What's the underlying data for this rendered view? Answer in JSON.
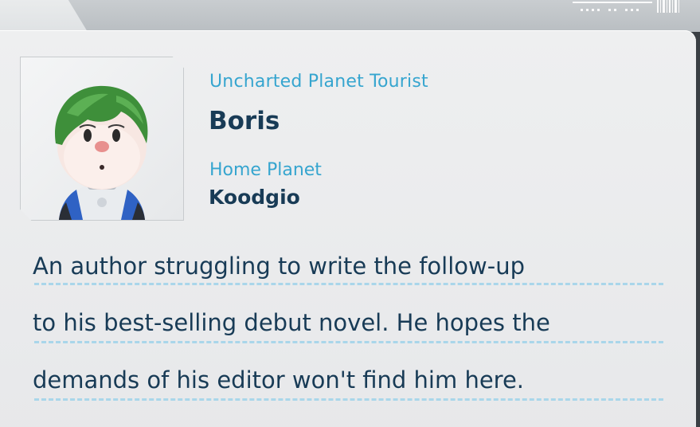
{
  "profile": {
    "role": "Uncharted Planet Tourist",
    "name": "Boris",
    "home_planet_label": "Home Planet",
    "home_planet": "Koodgio"
  },
  "description": {
    "lines": [
      "An author struggling to write the follow-up",
      "to his best-selling debut novel. He hopes the",
      "demands of his editor won't find him here."
    ]
  },
  "colors": {
    "label_blue": "#36a5cf",
    "text_navy": "#183b56",
    "card": "#eeeff0",
    "rule": "#a9d6ea"
  },
  "icons": {
    "portrait": "character-portrait",
    "barcode": "barcode-decoration"
  }
}
